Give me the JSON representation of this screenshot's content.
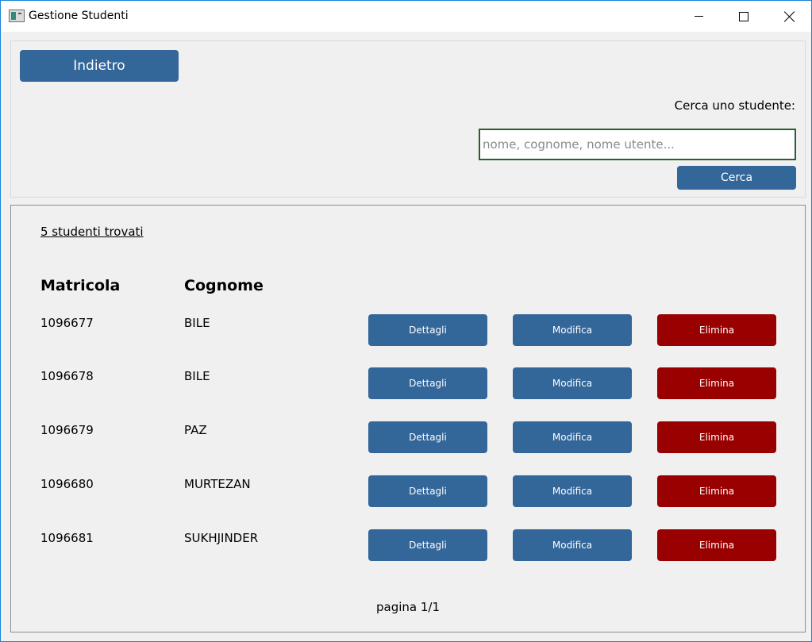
{
  "window": {
    "title": "Gestione Studenti"
  },
  "toolbar": {
    "back_label": "Indietro",
    "search_label": "Cerca uno studente:",
    "search_placeholder": "nome, cognome, nome utente...",
    "search_value": "",
    "search_button_label": "Cerca"
  },
  "results": {
    "count_text": "5 studenti trovati",
    "headers": {
      "matricola": "Matricola",
      "cognome": "Cognome"
    },
    "rows": [
      {
        "matricola": "1096677",
        "cognome": "BILE",
        "details": "Dettagli",
        "edit": "Modifica",
        "delete": "Elimina"
      },
      {
        "matricola": "1096678",
        "cognome": "BILE",
        "details": "Dettagli",
        "edit": "Modifica",
        "delete": "Elimina"
      },
      {
        "matricola": "1096679",
        "cognome": "PAZ",
        "details": "Dettagli",
        "edit": "Modifica",
        "delete": "Elimina"
      },
      {
        "matricola": "1096680",
        "cognome": "MURTEZAN",
        "details": "Dettagli",
        "edit": "Modifica",
        "delete": "Elimina"
      },
      {
        "matricola": "1096681",
        "cognome": "SUKHJINDER",
        "details": "Dettagli",
        "edit": "Modifica",
        "delete": "Elimina"
      }
    ],
    "pagination": "pagina 1/1"
  },
  "colors": {
    "primary_button": "#336699",
    "danger_button": "#990000",
    "window_background": "#f0f0f0"
  },
  "icons": {
    "app": "app-window-icon",
    "minimize": "minimize-icon",
    "maximize": "maximize-icon",
    "close": "close-icon"
  }
}
